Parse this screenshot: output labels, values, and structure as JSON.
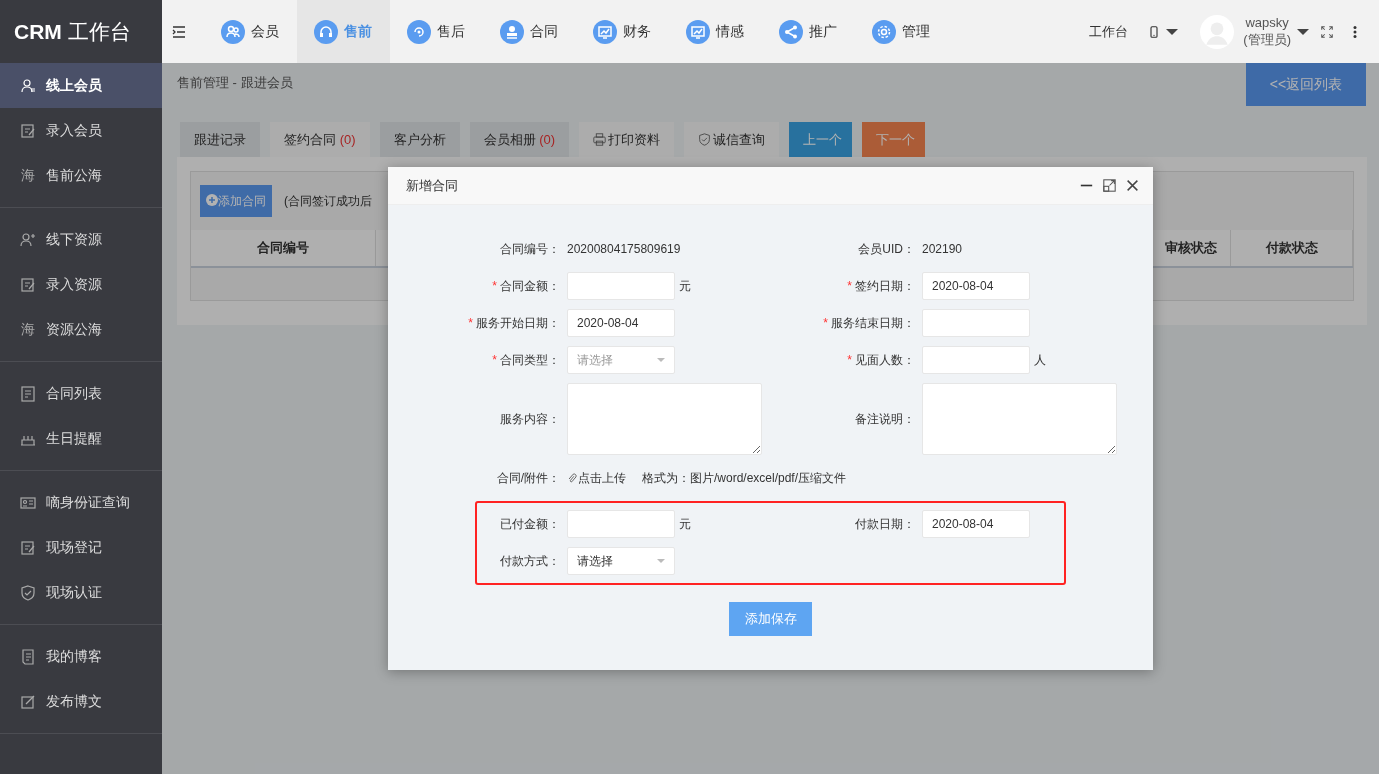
{
  "logo": {
    "bold": "CRM",
    "text": "工作台"
  },
  "sidebar": {
    "groups": [
      {
        "items": [
          {
            "label": "线上会员",
            "selected": true
          },
          {
            "label": "录入会员",
            "selected": false
          },
          {
            "label": "售前公海",
            "icon_text": "海",
            "selected": false
          }
        ]
      },
      {
        "items": [
          {
            "label": "线下资源",
            "selected": false
          },
          {
            "label": "录入资源",
            "selected": false
          },
          {
            "label": "资源公海",
            "icon_text": "海",
            "selected": false
          }
        ]
      },
      {
        "items": [
          {
            "label": "合同列表",
            "selected": false
          },
          {
            "label": "生日提醒",
            "selected": false
          }
        ]
      },
      {
        "items": [
          {
            "label": "嘀身份证查询",
            "selected": false
          },
          {
            "label": "现场登记",
            "selected": false
          },
          {
            "label": "现场认证",
            "selected": false
          }
        ]
      },
      {
        "items": [
          {
            "label": "我的博客",
            "selected": false
          },
          {
            "label": "发布博文",
            "selected": false
          }
        ]
      }
    ]
  },
  "topnav": [
    {
      "label": "会员",
      "selected": false
    },
    {
      "label": "售前",
      "selected": true
    },
    {
      "label": "售后",
      "selected": false
    },
    {
      "label": "合同",
      "selected": false
    },
    {
      "label": "财务",
      "selected": false
    },
    {
      "label": "情感",
      "selected": false
    },
    {
      "label": "推广",
      "selected": false
    },
    {
      "label": "管理",
      "selected": false
    }
  ],
  "header_right": {
    "workbench": "工作台",
    "user_name": "wapsky",
    "user_role": "(管理员)"
  },
  "breadcrumb": "售前管理 - 跟进会员",
  "back_button": "<<返回列表",
  "tabs": [
    {
      "label": "跟进记录",
      "kind": "tab",
      "selected": false
    },
    {
      "label": "签约合同",
      "count": "(0)",
      "kind": "tab",
      "selected": true
    },
    {
      "label": "客户分析",
      "kind": "tab",
      "selected": false
    },
    {
      "label": "会员相册",
      "count": "(0)",
      "kind": "tab",
      "selected": false
    },
    {
      "label": "打印资料",
      "kind": "tool"
    },
    {
      "label": "诚信查询",
      "kind": "tool"
    },
    {
      "label": "上一个",
      "kind": "prev"
    },
    {
      "label": "下一个",
      "kind": "next"
    }
  ],
  "panel": {
    "add_button": "添加合同",
    "note": "(合同签订成功后",
    "columns": [
      "合同编号",
      "审核状态",
      "付款状态"
    ]
  },
  "modal": {
    "title": "新增合同",
    "submit": "添加保存",
    "sections": [
      {
        "kind": "plain",
        "rows": [
          [
            {
              "label": "合同编号：",
              "kind": "text",
              "value": "20200804175809619"
            },
            {
              "label": "会员UID：",
              "kind": "text",
              "value": "202190"
            }
          ],
          [
            {
              "marker": "*",
              "label": "合同金额：",
              "kind": "input",
              "unit": "元"
            },
            {
              "marker": "*",
              "label": "签约日期：",
              "kind": "input",
              "value": "2020-08-04"
            }
          ],
          [
            {
              "marker": "*",
              "label": "服务开始日期：",
              "kind": "input",
              "value": "2020-08-04"
            },
            {
              "marker": "*",
              "label": "服务结束日期：",
              "kind": "input"
            }
          ],
          [
            {
              "marker": "*",
              "label": "合同类型：",
              "kind": "select",
              "placeholder": "请选择"
            },
            {
              "marker": "*",
              "label": "见面人数：",
              "kind": "input",
              "unit": "人"
            }
          ],
          [
            {
              "label": "服务内容：",
              "kind": "textarea"
            },
            {
              "label": "备注说明：",
              "kind": "textarea"
            }
          ],
          [
            {
              "label": "合同/附件：",
              "kind": "upload",
              "value": "点击上传",
              "note": "格式为：图片/word/excel/pdf/压缩文件"
            }
          ]
        ]
      },
      {
        "kind": "boxed",
        "rows": [
          [
            {
              "label": "已付金额：",
              "kind": "input",
              "unit": "元"
            },
            {
              "label": "付款日期：",
              "kind": "input",
              "value": "2020-08-04"
            }
          ],
          [
            {
              "label": "付款方式：",
              "kind": "select",
              "value": "请选择"
            }
          ]
        ]
      }
    ]
  }
}
